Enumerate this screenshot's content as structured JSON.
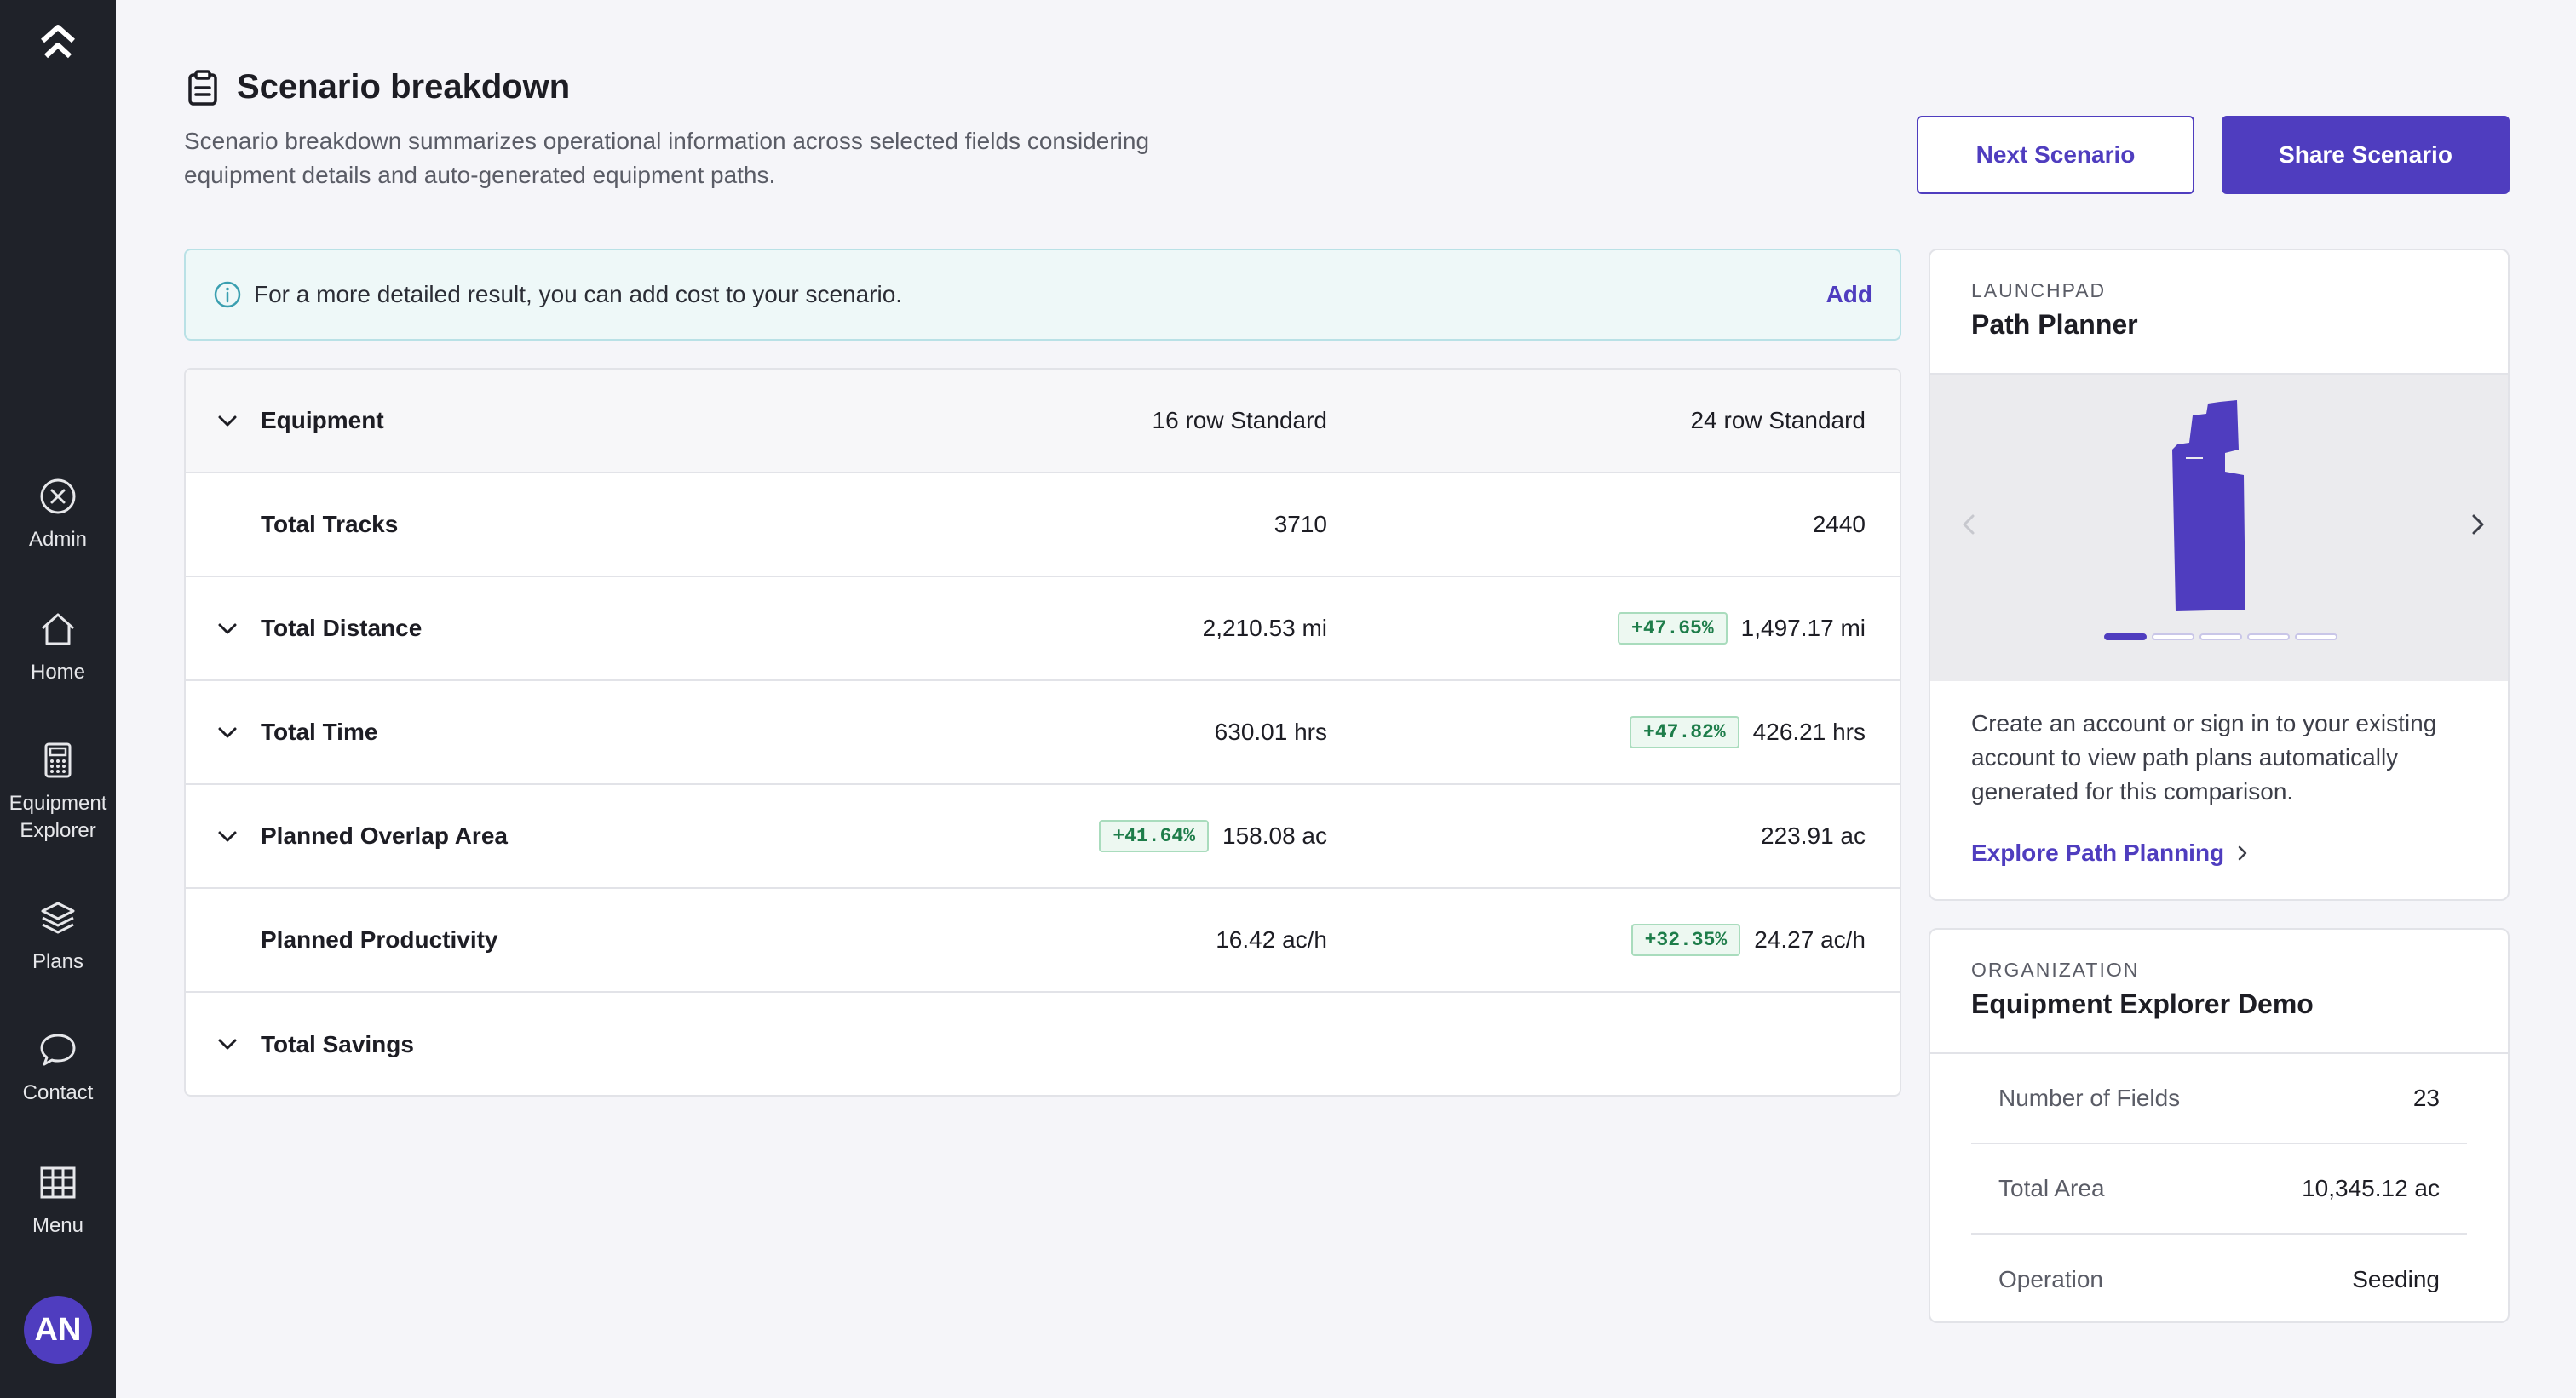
{
  "sidebar": {
    "items": [
      {
        "label": "Admin",
        "icon": "close-circle-icon"
      },
      {
        "label": "Home",
        "icon": "home-icon"
      },
      {
        "label": "Equipment Explorer",
        "icon": "calculator-icon"
      },
      {
        "label": "Plans",
        "icon": "layers-icon"
      },
      {
        "label": "Contact",
        "icon": "chat-bubble-icon"
      },
      {
        "label": "Menu",
        "icon": "grid-icon"
      }
    ],
    "avatar_initials": "AN"
  },
  "header": {
    "title": "Scenario breakdown",
    "description": "Scenario breakdown summarizes operational information across selected fields considering equipment details and auto-generated equipment paths.",
    "next_button": "Next Scenario",
    "share_button": "Share Scenario"
  },
  "banner": {
    "text": "For a more detailed result, you can add cost to your scenario.",
    "action": "Add"
  },
  "table": {
    "header": {
      "label": "Equipment",
      "col1": "16 row Standard",
      "col2": "24 row Standard"
    },
    "rows": [
      {
        "label": "Total Tracks",
        "col1": "3710",
        "col2": "2440",
        "badge1": "",
        "badge2": ""
      },
      {
        "label": "Total Distance",
        "col1": "2,210.53 mi",
        "col2": "1,497.17 mi",
        "badge1": "",
        "badge2": "+47.65%"
      },
      {
        "label": "Total Time",
        "col1": "630.01 hrs",
        "col2": "426.21 hrs",
        "badge1": "",
        "badge2": "+47.82%"
      },
      {
        "label": "Planned Overlap Area",
        "col1": "158.08 ac",
        "col2": "223.91 ac",
        "badge1": "+41.64%",
        "badge2": ""
      },
      {
        "label": "Planned Productivity",
        "col1": "16.42 ac/h",
        "col2": "24.27 ac/h",
        "badge1": "",
        "badge2": "+32.35%"
      },
      {
        "label": "Total Savings",
        "col1": "",
        "col2": "",
        "badge1": "",
        "badge2": ""
      }
    ]
  },
  "launchpad": {
    "kicker": "LAUNCHPAD",
    "title": "Path Planner",
    "carousel_slide": 1,
    "carousel_total": 5,
    "description": "Create an account or sign in to your existing account to view path plans automatically generated for this comparison.",
    "link": "Explore Path Planning"
  },
  "organization": {
    "kicker": "ORGANIZATION",
    "title": "Equipment Explorer Demo",
    "rows": [
      {
        "label": "Number of Fields",
        "value": "23"
      },
      {
        "label": "Total Area",
        "value": "10,345.12 ac"
      },
      {
        "label": "Operation",
        "value": "Seeding"
      }
    ]
  },
  "colors": {
    "accent": "#4f3dbf",
    "sidebar": "#1f2229",
    "positive": "#1e7d4a"
  }
}
